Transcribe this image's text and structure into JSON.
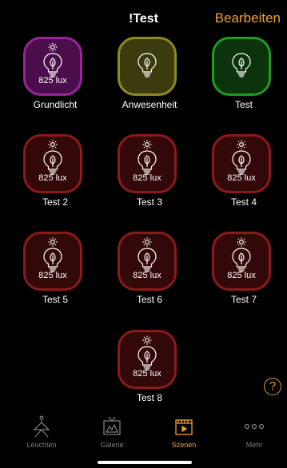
{
  "header": {
    "title": "!Test",
    "edit_label": "Bearbeiten"
  },
  "scenes": [
    {
      "label": "Grundlicht",
      "lux": "825 lux",
      "color": "#9a239a",
      "style": "purple"
    },
    {
      "label": "Anwesenheit",
      "lux": "",
      "color": "#8c8a25",
      "style": "yellow"
    },
    {
      "label": "Test",
      "lux": "",
      "color": "#229922",
      "style": "green"
    },
    {
      "label": "Test 2",
      "lux": "825 lux",
      "color": "#8c1a1a",
      "style": "red"
    },
    {
      "label": "Test 3",
      "lux": "825 lux",
      "color": "#8c1a1a",
      "style": "red"
    },
    {
      "label": "Test 4",
      "lux": "825 lux",
      "color": "#8c1a1a",
      "style": "red"
    },
    {
      "label": "Test 5",
      "lux": "825 lux",
      "color": "#8c1a1a",
      "style": "red"
    },
    {
      "label": "Test 6",
      "lux": "825 lux",
      "color": "#8c1a1a",
      "style": "red"
    },
    {
      "label": "Test 7",
      "lux": "825 lux",
      "color": "#8c1a1a",
      "style": "red"
    },
    {
      "label": "Test 8",
      "lux": "825 lux",
      "color": "#8c1a1a",
      "style": "red"
    }
  ],
  "help_icon": "question-mark-icon",
  "help_text": "?",
  "tabs": [
    {
      "label": "Leuchten",
      "icon": "lamp-icon",
      "active": false
    },
    {
      "label": "Galerie",
      "icon": "gallery-icon",
      "active": false
    },
    {
      "label": "Szenen",
      "icon": "scene-clapper-icon",
      "active": true
    },
    {
      "label": "Mehr",
      "icon": "more-dots-icon",
      "active": false
    }
  ],
  "colors": {
    "accent": "#f0a030",
    "inactive_tab": "#7a7a7a",
    "background": "#000000"
  }
}
